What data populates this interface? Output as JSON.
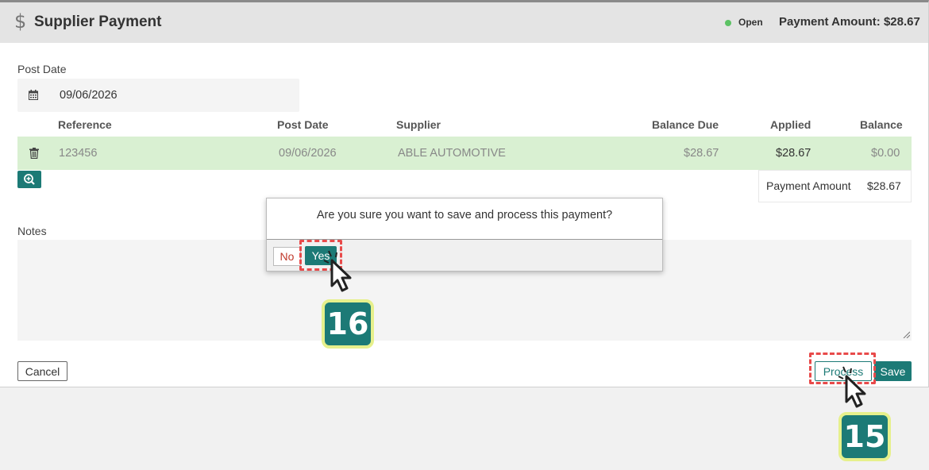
{
  "header": {
    "icon": "dollar-icon",
    "icon_glyph": "$",
    "title": "Supplier Payment",
    "status": "Open",
    "status_color": "#5cc264",
    "payment_amount": "Payment Amount: $28.67"
  },
  "post_date": {
    "label": "Post Date",
    "value": "09/06/2026",
    "icon": "calendar-icon"
  },
  "table": {
    "columns": [
      "Reference",
      "Post Date",
      "Supplier",
      "Balance Due",
      "Applied",
      "Balance"
    ],
    "rows": [
      {
        "reference": "123456",
        "post_date": "09/06/2026",
        "supplier": "ABLE AUTOMOTIVE",
        "balance_due": "$28.67",
        "applied": "$28.67",
        "balance": "$0.00"
      }
    ],
    "row_color": "#d9f0d2"
  },
  "summary": {
    "label": "Payment Amount",
    "value": "$28.67"
  },
  "notes": {
    "label": "Notes",
    "value": ""
  },
  "buttons": {
    "cancel": "Cancel",
    "process": "Process",
    "save": "Save"
  },
  "dialog": {
    "message": "Are you sure you want to save and process this payment?",
    "no": "No",
    "yes": "Yes"
  },
  "annotations": {
    "step_yes": "16",
    "step_process": "15",
    "accent": "#1c7a76",
    "highlight_color": "#e84a4a"
  }
}
